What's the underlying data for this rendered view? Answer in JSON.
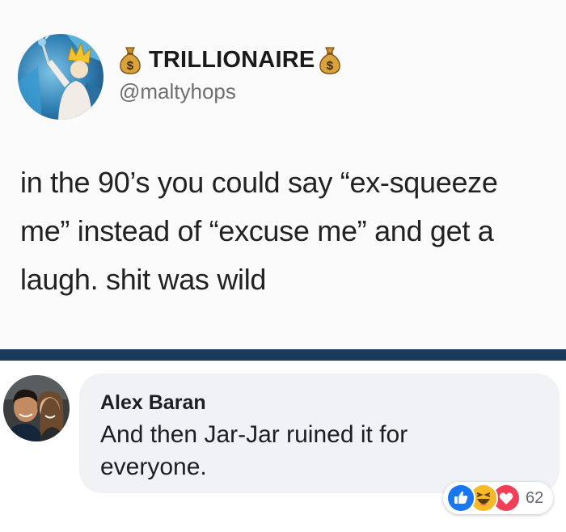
{
  "tweet": {
    "display_name": "TRILLIONAIRE",
    "handle": "@maltyhops",
    "text": "in the 90’s you could say “ex-squeeze\nme” instead of “excuse me” and get a\nlaugh. shit was wild",
    "icons": {
      "avatar": "king-with-crown-avatar",
      "badge": "money-bag-icon"
    }
  },
  "divider_color": "#1c3a5c",
  "comment": {
    "author": "Alex Baran",
    "text": "And then Jar-Jar ruined it for\neveryone.",
    "reactions": {
      "types": [
        "like",
        "haha",
        "love"
      ],
      "count": "62"
    },
    "colors": {
      "like": "#1877f2",
      "haha": "#f7b928",
      "love": "#f33e58",
      "bubble": "#f0f2f5"
    }
  }
}
